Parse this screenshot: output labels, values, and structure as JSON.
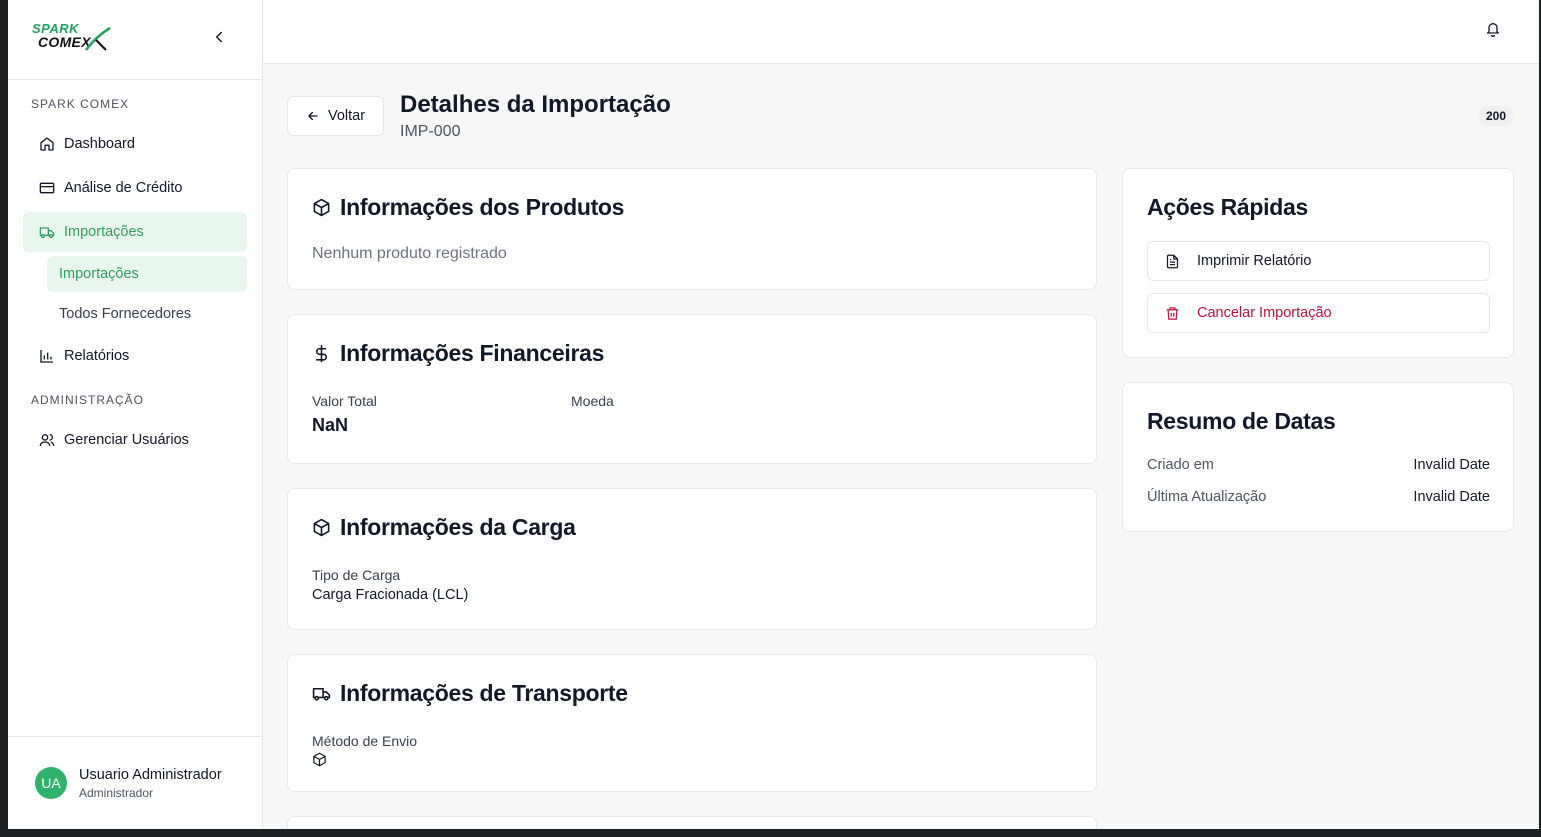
{
  "brand": {
    "line1": "SPARK",
    "line2": "COMEX"
  },
  "sidebar": {
    "section1": "SPARK COMEX",
    "items": [
      {
        "label": "Dashboard",
        "icon": "home-icon"
      },
      {
        "label": "Análise de Crédito",
        "icon": "credit-card-icon"
      },
      {
        "label": "Importações",
        "icon": "truck-icon"
      },
      {
        "label": "Relatórios",
        "icon": "bar-chart-icon"
      }
    ],
    "subitems": [
      {
        "label": "Importações"
      },
      {
        "label": "Todos Fornecedores"
      }
    ],
    "section2": "ADMINISTRAÇÃO",
    "admin_items": [
      {
        "label": "Gerenciar Usuários",
        "icon": "users-icon"
      }
    ],
    "user": {
      "initials": "UA",
      "name": "Usuario Administrador",
      "role": "Administrador"
    }
  },
  "header": {
    "back_label": "Voltar",
    "title": "Detalhes da Importação",
    "subtitle": "IMP-000",
    "badge": "200"
  },
  "products": {
    "title": "Informações dos Produtos",
    "empty": "Nenhum produto registrado"
  },
  "financial": {
    "title": "Informações Financeiras",
    "total_label": "Valor Total",
    "total_value": "NaN",
    "currency_label": "Moeda",
    "currency_value": ""
  },
  "cargo": {
    "title": "Informações da Carga",
    "type_label": "Tipo de Carga",
    "type_value": "Carga Fracionada (LCL)"
  },
  "transport": {
    "title": "Informações de Transporte",
    "method_label": "Método de Envio"
  },
  "quick_actions": {
    "title": "Ações Rápidas",
    "print_label": "Imprimir Relatório",
    "cancel_label": "Cancelar Importação",
    "cancel_color": "#be123c"
  },
  "dates": {
    "title": "Resumo de Datas",
    "rows": [
      {
        "label": "Criado em",
        "value": "Invalid Date"
      },
      {
        "label": "Última Atualização",
        "value": "Invalid Date"
      }
    ]
  },
  "colors": {
    "accent": "#2f9e5f",
    "accent_bg": "#e8f7ee",
    "danger": "#be123c"
  }
}
